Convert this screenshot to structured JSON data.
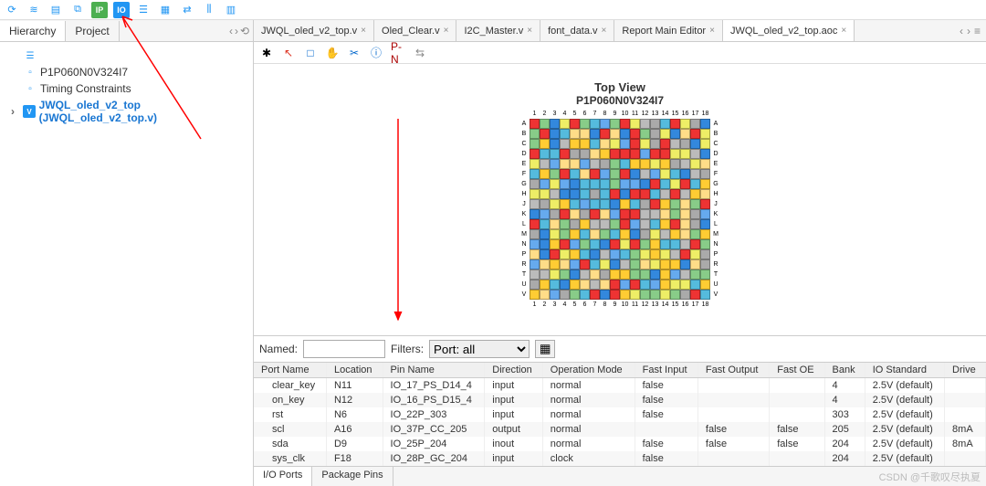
{
  "toolbar_icons": [
    {
      "name": "refresh-icon",
      "glyph": "⟳",
      "cls": "plain"
    },
    {
      "name": "layers-icon",
      "glyph": "≋",
      "cls": "plain"
    },
    {
      "name": "doc-icon",
      "glyph": "▤",
      "cls": "plain"
    },
    {
      "name": "copy-icon",
      "glyph": "⧉",
      "cls": "plain"
    },
    {
      "name": "ip-icon",
      "glyph": "IP",
      "cls": "ip"
    },
    {
      "name": "io-icon",
      "glyph": "IO",
      "cls": "io"
    },
    {
      "name": "list-icon",
      "glyph": "☰",
      "cls": "plain"
    },
    {
      "name": "grid-icon",
      "glyph": "▦",
      "cls": "plain"
    },
    {
      "name": "share-icon",
      "glyph": "⇄",
      "cls": "plain"
    },
    {
      "name": "chart-icon",
      "glyph": "⫼",
      "cls": "plain"
    },
    {
      "name": "report-icon",
      "glyph": "▥",
      "cls": "plain"
    }
  ],
  "sidebar": {
    "tabs": [
      "Hierarchy",
      "Project"
    ],
    "tree": {
      "device": "P1P060N0V324I7",
      "timing": "Timing Constraints",
      "top": "JWQL_oled_v2_top (JWQL_oled_v2_top.v)"
    }
  },
  "tabs": [
    {
      "label": "JWQL_oled_v2_top.v",
      "active": false
    },
    {
      "label": "Oled_Clear.v",
      "active": false
    },
    {
      "label": "I2C_Master.v",
      "active": false
    },
    {
      "label": "font_data.v",
      "active": false
    },
    {
      "label": "Report Main Editor",
      "active": false
    },
    {
      "label": "JWQL_oled_v2_top.aoc",
      "active": true
    }
  ],
  "sub_icons": [
    {
      "name": "target-icon",
      "glyph": "✱",
      "color": "#000"
    },
    {
      "name": "cursor-icon",
      "glyph": "↖",
      "color": "#d32"
    },
    {
      "name": "cut-icon",
      "glyph": "□",
      "color": "#06c"
    },
    {
      "name": "hand-icon",
      "glyph": "✋",
      "color": "#c90"
    },
    {
      "name": "crop-icon",
      "glyph": "✂",
      "color": "#06c"
    },
    {
      "name": "info-icon",
      "glyph": "ⓘ",
      "color": "#06c"
    },
    {
      "name": "pn-label",
      "glyph": "P-N",
      "color": "#a00"
    },
    {
      "name": "swap-icon",
      "glyph": "⇆",
      "color": "#888"
    }
  ],
  "chip": {
    "title": "Top View",
    "subtitle": "P1P060N0V324I7",
    "cols": [
      "1",
      "2",
      "3",
      "4",
      "5",
      "6",
      "7",
      "8",
      "9",
      "10",
      "11",
      "12",
      "13",
      "14",
      "15",
      "16",
      "17",
      "18"
    ],
    "rows": [
      "A",
      "B",
      "C",
      "D",
      "E",
      "F",
      "G",
      "H",
      "J",
      "K",
      "L",
      "M",
      "N",
      "P",
      "R",
      "T",
      "U",
      "V"
    ]
  },
  "filter": {
    "named_label": "Named:",
    "filters_label": "Filters:",
    "port_option": "Port: all"
  },
  "table": {
    "headers": [
      "Port Name",
      "Location",
      "Pin Name",
      "Direction",
      "Operation Mode",
      "Fast Input",
      "Fast Output",
      "Fast OE",
      "Bank",
      "IO Standard",
      "Drive"
    ],
    "rows": [
      {
        "port": "clear_key",
        "loc": "N11",
        "pin": "IO_17_PS_D14_4",
        "dir": "input",
        "op": "normal",
        "fi": "false",
        "fo": "",
        "foe": "",
        "bank": "4",
        "std": "2.5V (default)",
        "drv": ""
      },
      {
        "port": "on_key",
        "loc": "N12",
        "pin": "IO_16_PS_D15_4",
        "dir": "input",
        "op": "normal",
        "fi": "false",
        "fo": "",
        "foe": "",
        "bank": "4",
        "std": "2.5V (default)",
        "drv": ""
      },
      {
        "port": "rst",
        "loc": "N6",
        "pin": "IO_22P_303",
        "dir": "input",
        "op": "normal",
        "fi": "false",
        "fo": "",
        "foe": "",
        "bank": "303",
        "std": "2.5V (default)",
        "drv": ""
      },
      {
        "port": "scl",
        "loc": "A16",
        "pin": "IO_37P_CC_205",
        "dir": "output",
        "op": "normal",
        "fi": "",
        "fo": "false",
        "foe": "false",
        "bank": "205",
        "std": "2.5V (default)",
        "drv": "8mA"
      },
      {
        "port": "sda",
        "loc": "D9",
        "pin": "IO_25P_204",
        "dir": "inout",
        "op": "normal",
        "fi": "false",
        "fo": "false",
        "foe": "false",
        "bank": "204",
        "std": "2.5V (default)",
        "drv": "8mA"
      },
      {
        "port": "sys_clk",
        "loc": "F18",
        "pin": "IO_28P_GC_204",
        "dir": "input",
        "op": "clock",
        "fi": "false",
        "fo": "",
        "foe": "",
        "bank": "204",
        "std": "2.5V (default)",
        "drv": ""
      }
    ]
  },
  "bottom_tabs": [
    "I/O Ports",
    "Package Pins"
  ],
  "watermark": "CSDN @千歌叹尽执夏"
}
